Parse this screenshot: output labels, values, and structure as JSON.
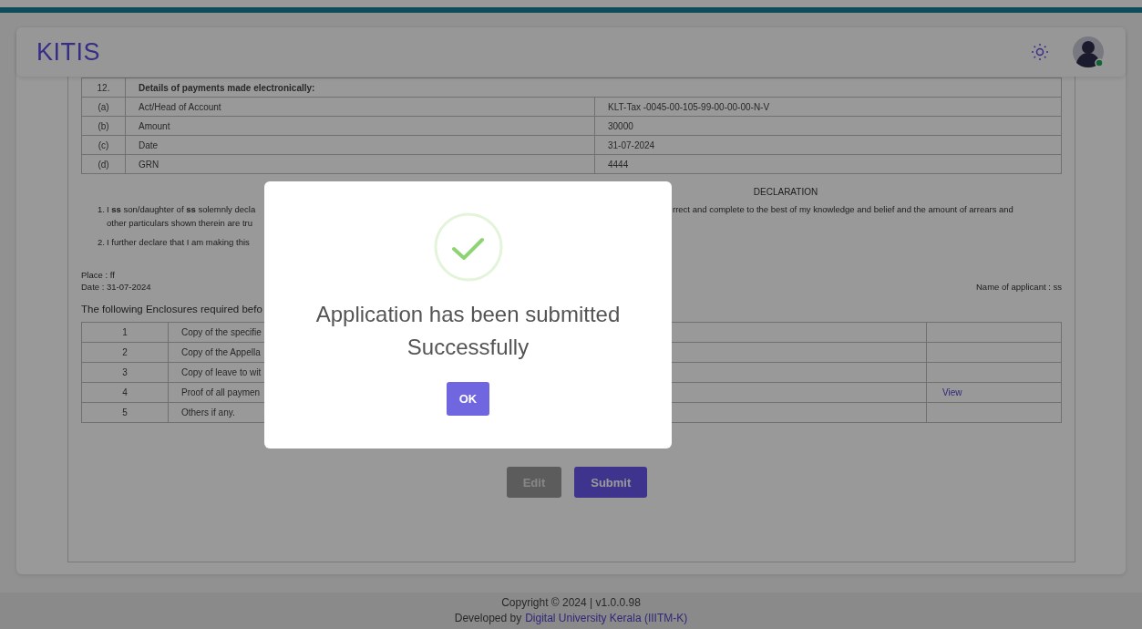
{
  "header": {
    "logo": "KITIS"
  },
  "payments": {
    "rows": [
      {
        "kind": "heading",
        "no": "12.",
        "label": "Details of payments made electronically:"
      },
      {
        "kind": "field",
        "no": "(a)",
        "label": "Act/Head of Account",
        "value": "KLT-Tax -0045-00-105-99-00-00-00-N-V"
      },
      {
        "kind": "field",
        "no": "(b)",
        "label": "Amount",
        "value": "30000"
      },
      {
        "kind": "field",
        "no": "(c)",
        "label": "Date",
        "value": "31-07-2024"
      },
      {
        "kind": "field",
        "no": "(d)",
        "label": "GRN",
        "value": "4444"
      }
    ]
  },
  "declaration": {
    "heading": "DECLARATION",
    "items": [
      {
        "number": "1.",
        "left_lines": [
          "I **ss** son/daughter of **ss** solemnly decla",
          "other particulars shown therein are tru"
        ],
        "right_lines": [
          "rrect and complete to the best of my knowledge and belief and the amount of arrears and"
        ]
      },
      {
        "number": "2.",
        "left_lines": [
          "I further declare that I am making this"
        ]
      }
    ]
  },
  "place": "Place :  ff",
  "date": "Date :  31-07-2024",
  "applicant": "Name of applicant :  ss",
  "enclosures": {
    "intro": "The following Enclosures required befo",
    "rows": [
      {
        "no": "1",
        "description": "Copy of the specifie"
      },
      {
        "no": "2",
        "description": "Copy of the Appella"
      },
      {
        "no": "3",
        "description": "Copy of leave to wit"
      },
      {
        "no": "4",
        "description": "Proof of all paymen",
        "link": "View"
      },
      {
        "no": "5",
        "description": "Others if any."
      }
    ]
  },
  "buttons": [
    {
      "label": "Edit",
      "disabled": true
    },
    {
      "label": "Submit",
      "disabled": false
    }
  ],
  "dialog": {
    "title": "Application has been submitted Successfully",
    "button": "OK"
  },
  "footer": {
    "copyright": "Copyright © 2024 | v1.0.0.98",
    "developed_prefix": "Developed by",
    "link": "Digital University Kerala (IIITM-K)"
  }
}
